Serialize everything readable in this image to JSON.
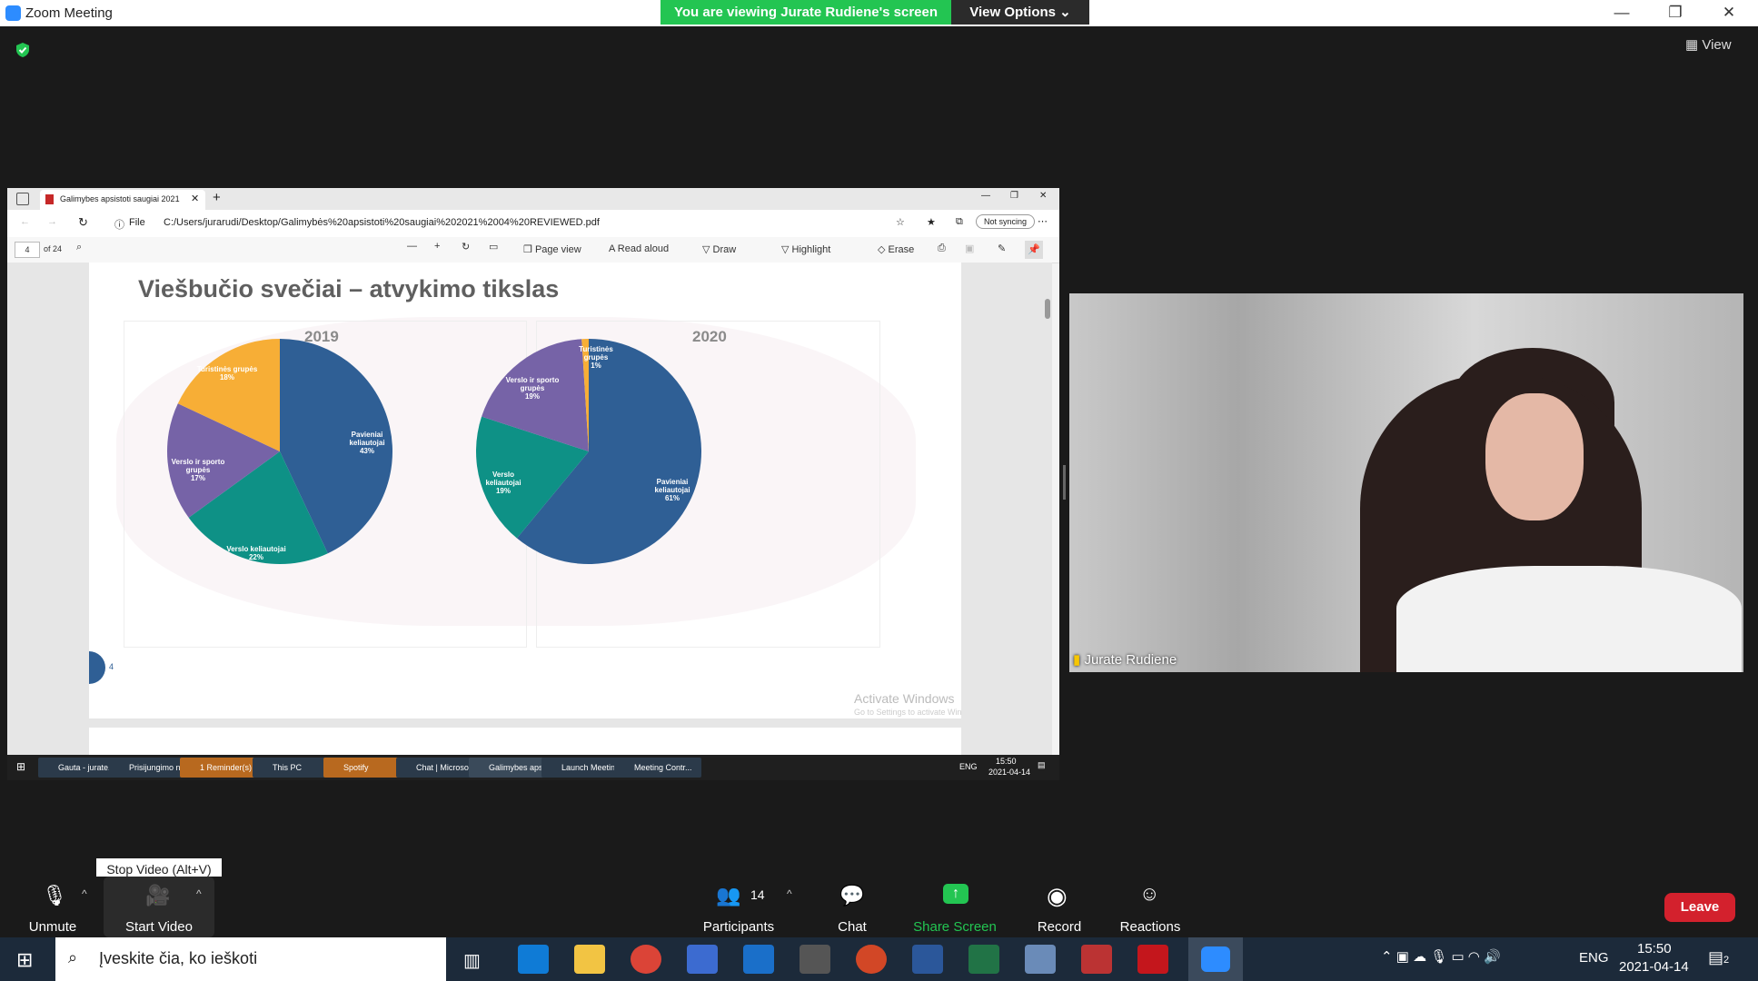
{
  "window": {
    "title": "Zoom Meeting",
    "banner": "You are viewing Jurate Rudiene's screen",
    "view_options": "View Options",
    "view_button": "View"
  },
  "browser": {
    "tab_title": "Galimybes apsistoti saugiai 2021",
    "url_prefix": "File",
    "url": "C:/Users/jurarudi/Desktop/Galimybės%20apsistoti%20saugiai%202021%2004%20REVIEWED.pdf",
    "sync": "Not syncing",
    "page_num": "4",
    "page_total": "of 24",
    "toolbar": {
      "page_view": "Page view",
      "read_aloud": "Read aloud",
      "draw": "Draw",
      "highlight": "Highlight",
      "erase": "Erase"
    }
  },
  "slide": {
    "title": "Viešbučio svečiai – atvykimo tikslas",
    "page_number": "4",
    "watermark": "Activate Windows",
    "watermark_sub": "Go to Settings to activate Windows."
  },
  "chart_data": [
    {
      "type": "pie",
      "title": "2019",
      "slices": [
        {
          "label": "Pavieniai keliautojai",
          "value": 43,
          "color": "#2f5f95"
        },
        {
          "label": "Verslo keliautojai",
          "value": 22,
          "color": "#0e9186"
        },
        {
          "label": "Verslo ir sporto grupės",
          "value": 17,
          "color": "#7663a7"
        },
        {
          "label": "Turistinės grupės",
          "value": 18,
          "color": "#f7ae36"
        }
      ],
      "label_text": [
        "Pavieniai\nkeliautojai\n43%",
        "Verslo keliautojai\n22%",
        "Verslo ir sporto\ngrupės\n17%",
        "Turistinės grupės\n18%"
      ]
    },
    {
      "type": "pie",
      "title": "2020",
      "slices": [
        {
          "label": "Pavieniai keliautojai",
          "value": 61,
          "color": "#2f5f95"
        },
        {
          "label": "Verslo keliautojai",
          "value": 19,
          "color": "#0e9186"
        },
        {
          "label": "Verslo ir sporto grupės",
          "value": 19,
          "color": "#7663a7"
        },
        {
          "label": "Turistinės grupės",
          "value": 1,
          "color": "#f7ae36"
        }
      ],
      "label_text": [
        "Pavieniai\nkeliautojai\n61%",
        "Verslo\nkeliautojai\n19%",
        "Verslo ir sporto\ngrupės\n19%",
        "Turistinės\ngrupės\n1%"
      ]
    }
  ],
  "inner_taskbar": {
    "items": [
      "Gauta - jurate...",
      "Prisijungimo n...",
      "1 Reminder(s)",
      "This PC",
      "Spotify",
      "Chat | Microso...",
      "Galimybes aps...",
      "Launch Meetin...",
      "Meeting Contr..."
    ],
    "lang": "ENG",
    "time": "15:50",
    "date": "2021-04-14"
  },
  "video": {
    "name": "Jurate Rudiene"
  },
  "tooltip": "Stop Video (Alt+V)",
  "controls": {
    "unmute": "Unmute",
    "start_video": "Start Video",
    "participants": "Participants",
    "participants_count": "14",
    "chat": "Chat",
    "share": "Share Screen",
    "record": "Record",
    "reactions": "Reactions",
    "leave": "Leave"
  },
  "taskbar": {
    "search_placeholder": "Įveskite čia, ko ieškoti",
    "lang": "ENG",
    "time": "15:50",
    "date": "2021-04-14",
    "notifications": "2"
  },
  "colors": {
    "zoom_blue": "#2d8cff",
    "banner_green": "#23c552",
    "leave_red": "#d3212d"
  }
}
